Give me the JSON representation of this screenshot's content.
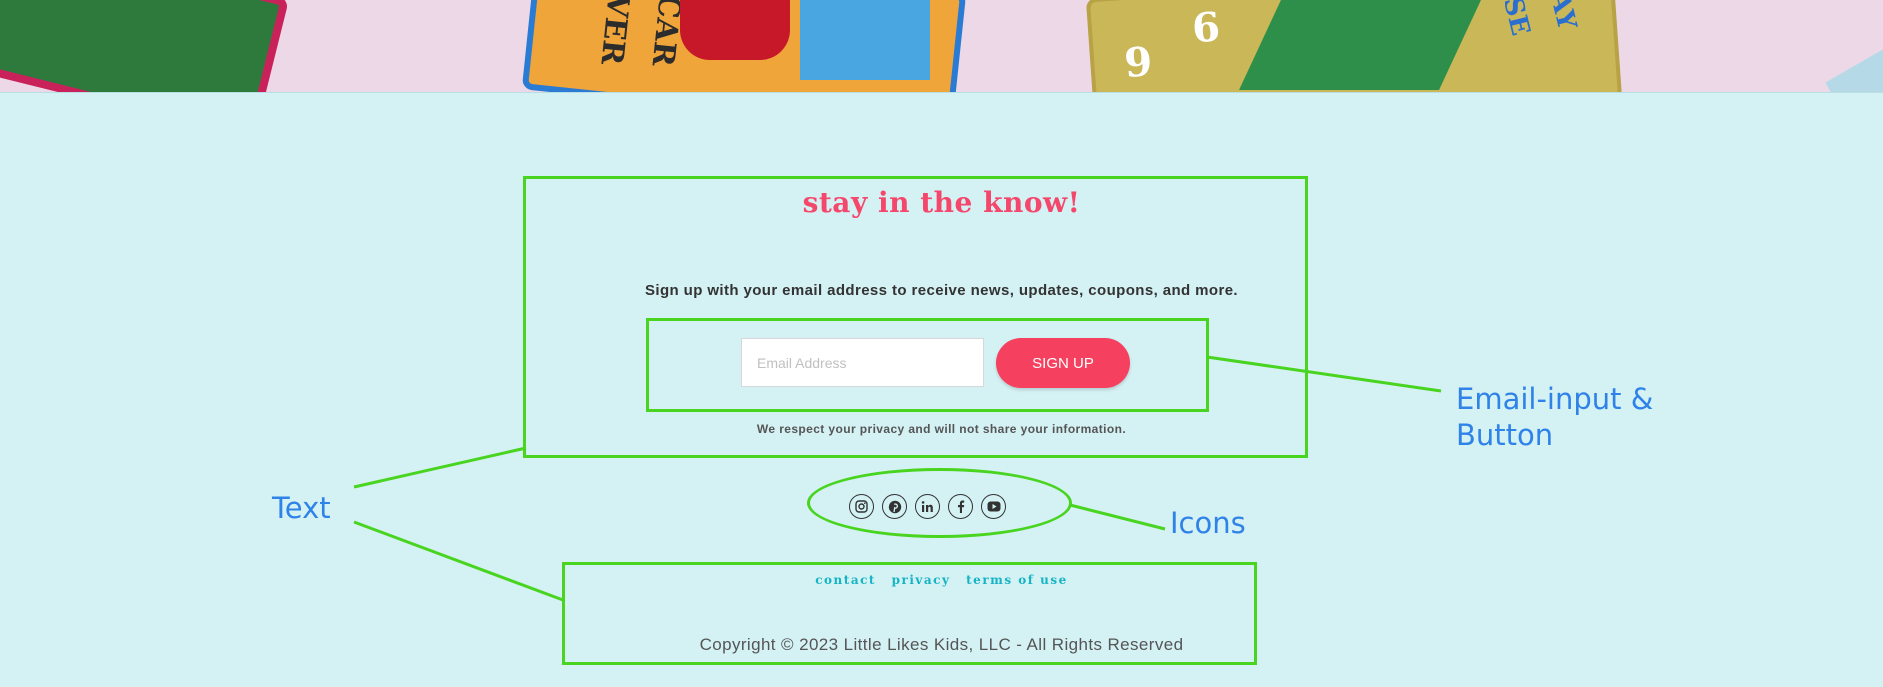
{
  "hero": {
    "card_text_1": "ACECAR",
    "card_text_2": "RIVER",
    "card_text_3": "9",
    "card_text_4": "6",
    "card_text_5": "BASE",
    "card_text_6": "PLAY"
  },
  "newsletter": {
    "title": "stay in the know!",
    "subtitle": "Sign up with your email address to receive news, updates, coupons, and more.",
    "email_placeholder": "Email Address",
    "email_value": "",
    "signup_label": "SIGN UP",
    "privacy_note": "We respect your privacy and will not share your information."
  },
  "social": {
    "icons": [
      "instagram-icon",
      "pinterest-icon",
      "linkedin-icon",
      "facebook-icon",
      "youtube-icon"
    ]
  },
  "footer": {
    "links": [
      "contact",
      "privacy",
      "terms of use"
    ],
    "copyright": "Copyright © 2023 Little Likes Kids, LLC - All Rights Reserved"
  },
  "annotations": {
    "text_label": "Text",
    "email_label_line1": "Email-input &",
    "email_label_line2": "Button",
    "icons_label": "Icons"
  },
  "colors": {
    "background": "#d4f1f4",
    "accent_pink": "#f5405f",
    "link_teal": "#14b4c4",
    "annotation_green": "#48d41f",
    "annotation_blue": "#2f83e8"
  }
}
